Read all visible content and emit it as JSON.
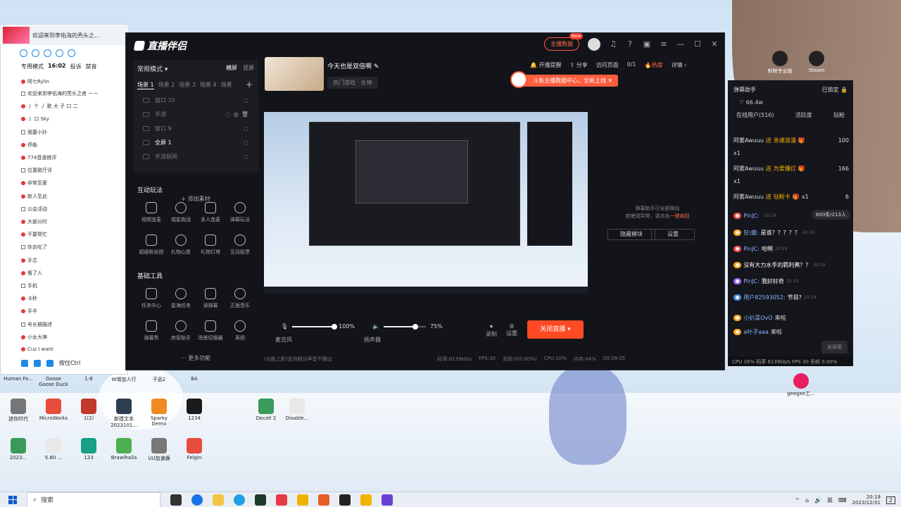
{
  "qq": {
    "title": "欢迎来到李佑海的秃头之...",
    "mode_label": "专用模式",
    "time": "16:02",
    "tab_a": "投诉",
    "tab_b": "禁音",
    "user_line": "阿七Rylin",
    "lines": [
      "欢迎来到李佑海的秃头之夜 ~·~",
      "丨 个 丿 歌 大 子 口 二",
      "丨 口 Sky",
      "我要小扑",
      "停勒",
      "774音波搭评",
      "位置歌厅评",
      "非常至爱",
      "新人至此",
      "公会活动",
      "大部分时",
      "不要帮忙",
      "你去吃了",
      "手芯",
      "看了人",
      "手机",
      "卡秒",
      "手半",
      "号长期描述",
      "小女大神",
      "Cuz I want"
    ],
    "bottom_label": "按住Ctrl"
  },
  "app": {
    "logo": "直播伴侣",
    "anchor_btn": "主播数据",
    "new_badge": "New",
    "mode": "常规模式",
    "orient_h": "横屏",
    "orient_v": "竖屏",
    "scenes": [
      "场景 1",
      "场景 2",
      "场景 3",
      "场景 4",
      "场景"
    ],
    "sources": [
      {
        "name": "窗口 10",
        "active": false
      },
      {
        "name": "手游",
        "active": false
      },
      {
        "name": "窗口 9",
        "active": false
      },
      {
        "name": "全屏 1",
        "active": true
      },
      {
        "name": "手游联网",
        "active": false
      }
    ],
    "add_source": "添加素材",
    "interactive_title": "互动玩法",
    "interactive_tools": [
      "视频连麦",
      "福星挑战",
      "多人连麦",
      "弹幕玩法",
      "超级粉丝团",
      "礼物心愿",
      "礼物灯塔",
      "互动投票"
    ],
    "basic_title": "基础工具",
    "basic_tools": [
      "任务中心",
      "星海任务",
      "读弹幕",
      "正版音乐",
      "弹幕秀",
      "房管助手",
      "场景切换器",
      "表扬"
    ],
    "more": "更多功能",
    "room_title": "今天也是双倍啊",
    "room_cat": "热门游戏 · 女神",
    "top_menu": {
      "remind": "开播提醒",
      "share": "分享",
      "visit": "访问页面",
      "count": "0/1",
      "hot": "热度",
      "detail": "详情"
    },
    "toast": "斗鱼主播数据中心，全新上线",
    "chat_off_1": "弹幕助手已全部弹出",
    "chat_off_2": "若使用异常，请点击",
    "chat_off_link": "一键收回",
    "hide_module": "隐藏模块",
    "settings": "设置",
    "mic_label": "麦克风",
    "mic_vol": "100%",
    "mic_level": 1.0,
    "spk_label": "扬声器",
    "spk_vol": "75%",
    "spk_level": 0.75,
    "record": "录制",
    "setting": "设置",
    "close_live": "关闭直播",
    "status": {
      "hint": "(功能上新)支持部分声音不播出",
      "bitrate": "码率:6139kb/s",
      "fps": "FPS:30",
      "drop": "丢帧:0(0.00%)",
      "cpu": "CPU:10%",
      "mem": "内存:44%",
      "time": "00:39:35"
    }
  },
  "danmu": {
    "title": "弹幕助手",
    "lock": "已锁定",
    "popularity": "66.4w",
    "tabs": [
      "在线用户(516)",
      "活跃度",
      "钻粉"
    ],
    "gifts": [
      {
        "user": "阿雾Awuuu",
        "verb": "送",
        "gift": "急速浪漫",
        "count": "x1",
        "num": "100"
      },
      {
        "user": "阿雾Awuuu",
        "verb": "送",
        "gift": "为爱爆灯",
        "count": "x1",
        "num": "166"
      },
      {
        "user": "阿雾Awuuu",
        "verb": "送",
        "gift": "钻粉卡",
        "count": "x1",
        "num": "6"
      }
    ],
    "count_pill": "600条/213人",
    "msgs": [
      {
        "user": "PinJC:",
        "text": "",
        "time": "20:19"
      },
      {
        "user": "狂\\傲:",
        "text": "是谁？？？？？",
        "time": "20:19"
      },
      {
        "user": "PinJC:",
        "text": "哈啊",
        "time": "20:19"
      },
      {
        "user": "",
        "text": "没有大力水手的羁利弗？？",
        "time": "20:19"
      },
      {
        "user": "PinJC:",
        "text": "我好好奇",
        "time": "20:19"
      },
      {
        "user": "用户82593052:",
        "text": "节目?",
        "time": "20:19"
      }
    ],
    "joins": [
      {
        "user": "小扒菜OvO",
        "verb": "来啦"
      },
      {
        "user": "a叶子aaa",
        "verb": "来啦"
      }
    ],
    "send": "发弹幕",
    "footer": "CPU 16%  码率 6139kb/s  FPS 30  丢帧 0.00%"
  },
  "desktop": {
    "icons_row1": [
      "Human Fa...",
      "Goose Goose Duck",
      "1-8",
      "W增加人行",
      "子品2",
      "BA"
    ],
    "icons_row2": [
      "迷你时代",
      "MicroWorks",
      "1(2)",
      "新建文本 2023101...",
      "Sparky Demo",
      "1234",
      "Decell 2",
      "Disable..."
    ],
    "icons_row3": [
      "2023...",
      "5.80 ...",
      "123",
      "Brawlhalla",
      "UU加速器",
      "Felgin"
    ],
    "right_icons": [
      "剪映专业版",
      "Steam",
      "geegee工..."
    ]
  },
  "taskbar": {
    "search": "搜索",
    "ime": "英",
    "time": "20:19",
    "date": "2023/12/31",
    "notif": "2"
  }
}
